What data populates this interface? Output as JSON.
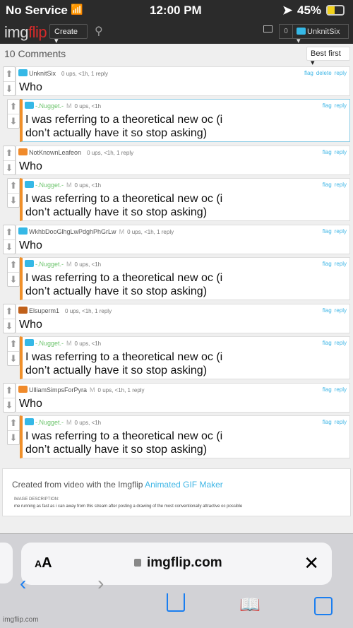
{
  "status": {
    "carrier": "No Service",
    "time": "12:00 PM",
    "battery": "45%"
  },
  "nav": {
    "logo_a": "img",
    "logo_b": "flip",
    "create": "Create ▾",
    "notifications": "0",
    "user": "UnknitSix ▾"
  },
  "comments_header": "10 Comments",
  "sort": "Best first ▾",
  "threads": [
    {
      "comment": {
        "user": "UnknitSix",
        "mod": "",
        "meta": "0 ups, <1h, 1 reply",
        "actions": [
          "flag",
          "delete",
          "reply"
        ],
        "text": "Who",
        "avatar_color": "#35b8e6"
      },
      "reply": {
        "user": "-.Nugget.-",
        "mod": "M",
        "meta": "0 ups, <1h",
        "actions": [
          "flag",
          "reply"
        ],
        "text": "I was referring to a theoretical new oc (i don’t actually have it so stop asking)"
      }
    },
    {
      "comment": {
        "user": "NotKnownLeafeon",
        "mod": "",
        "meta": "0 ups, <1h, 1 reply",
        "actions": [
          "flag",
          "reply"
        ],
        "text": "Who",
        "avatar_color": "#f08a2a"
      },
      "reply": {
        "user": "-.Nugget.-",
        "mod": "M",
        "meta": "0 ups, <1h",
        "actions": [
          "flag",
          "reply"
        ],
        "text": "I was referring to a theoretical new oc (i don’t actually have it so stop asking)"
      }
    },
    {
      "comment": {
        "user": "WkhbDooGlhgLwPdghPhGrLw",
        "mod": "M",
        "meta": "0 ups, <1h, 1 reply",
        "actions": [
          "flag",
          "reply"
        ],
        "text": "Who",
        "avatar_color": "#35b8e6"
      },
      "reply": {
        "user": "-.Nugget.-",
        "mod": "M",
        "meta": "0 ups, <1h",
        "actions": [
          "flag",
          "reply"
        ],
        "text": "I was referring to a theoretical new oc (i don’t actually have it so stop asking)"
      }
    },
    {
      "comment": {
        "user": "Elsuperm1",
        "mod": "",
        "meta": "0 ups, <1h, 1 reply",
        "actions": [
          "flag",
          "reply"
        ],
        "text": "Who",
        "avatar_color": "#c0601a"
      },
      "reply": {
        "user": "-.Nugget.-",
        "mod": "M",
        "meta": "0 ups, <1h",
        "actions": [
          "flag",
          "reply"
        ],
        "text": "I was referring to a theoretical new oc (i don’t actually have it so stop asking)"
      }
    },
    {
      "comment": {
        "user": "UlliamSimpsForPyra",
        "mod": "M",
        "meta": "0 ups, <1h, 1 reply",
        "actions": [
          "flag",
          "reply"
        ],
        "text": "Who",
        "avatar_color": "#f08a2a"
      },
      "reply": {
        "user": "-.Nugget.-",
        "mod": "M",
        "meta": "0 ups, <1h",
        "actions": [
          "flag",
          "reply"
        ],
        "text": "I was referring to a theoretical new oc (i don’t actually have it so stop asking)"
      }
    }
  ],
  "footer": {
    "created": "Created from video with the Imgflip ",
    "link": "Animated GIF Maker",
    "desc_label": "IMAGE DESCRIPTION:",
    "desc": "me running as fast as i can away from this stream after posting a drawing of the most conventionally attractive oc possible"
  },
  "safari": {
    "aa_small": "A",
    "aa_big": "A",
    "domain": "imgflip.com",
    "watermark": "imgflip.com"
  }
}
